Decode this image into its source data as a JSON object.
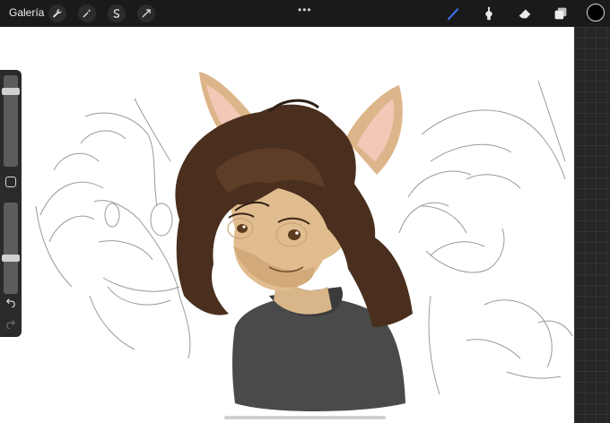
{
  "toolbar": {
    "gallery_label": "Galería",
    "left_tools": [
      {
        "icon": "wrench-icon"
      },
      {
        "icon": "magic-wand-icon"
      },
      {
        "icon": "selection-icon"
      },
      {
        "icon": "transform-icon"
      }
    ],
    "more_label": "•••",
    "right_tools": [
      {
        "icon": "brush-icon"
      },
      {
        "icon": "smudge-icon"
      },
      {
        "icon": "eraser-icon"
      },
      {
        "icon": "layers-icon"
      }
    ],
    "current_color": "#000000",
    "active_tool_color": "#3a78ff"
  },
  "sidebar": {
    "size_slider_value": 0.85,
    "opacity_slider_value": 0.38,
    "modifier_icon": "modifier-square-icon",
    "undo_icon": "undo-icon",
    "redo_icon": "redo-icon"
  },
  "canvas": {
    "subject": "illustration"
  }
}
